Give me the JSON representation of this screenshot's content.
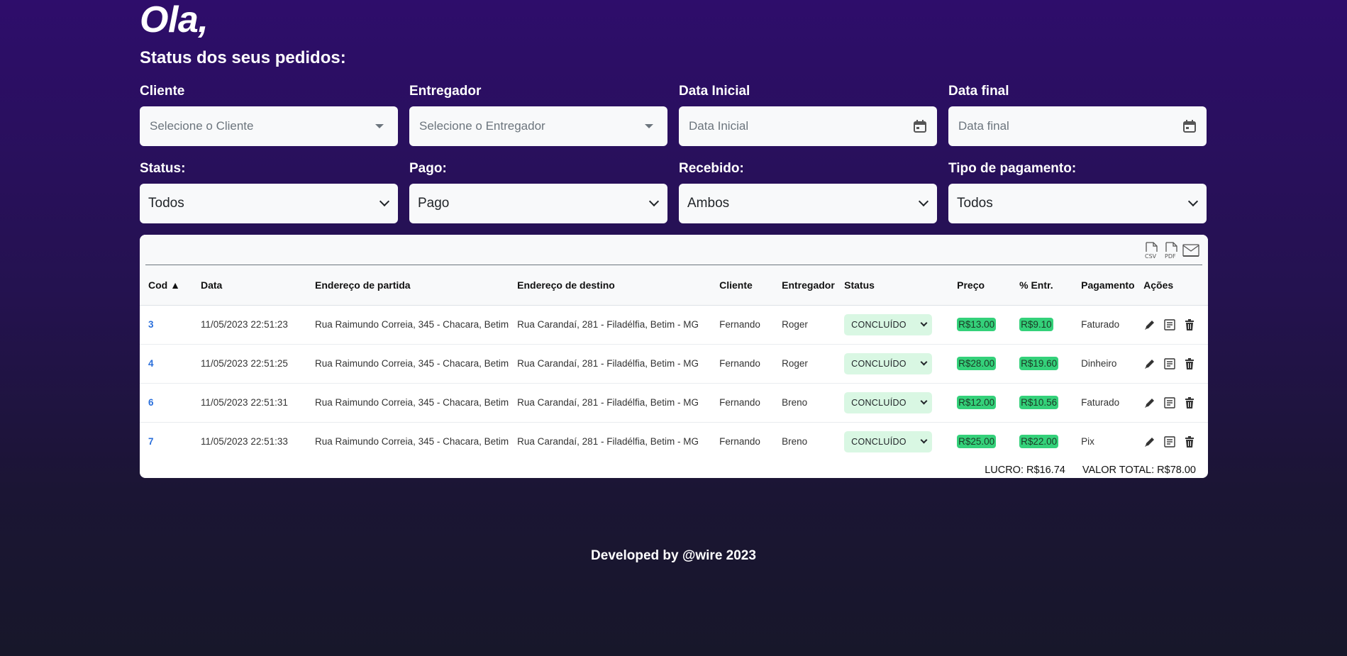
{
  "header": {
    "greeting": "Ola,",
    "subtitle": "Status dos seus pedidos:"
  },
  "filters": {
    "cliente": {
      "label": "Cliente",
      "placeholder": "Selecione o Cliente"
    },
    "entregador": {
      "label": "Entregador",
      "placeholder": "Selecione o Entregador"
    },
    "data_inicial": {
      "label": "Data Inicial",
      "placeholder": "Data Inicial"
    },
    "data_final": {
      "label": "Data final",
      "placeholder": "Data final"
    },
    "status": {
      "label": "Status:",
      "value": "Todos"
    },
    "pago": {
      "label": "Pago:",
      "value": "Pago"
    },
    "recebido": {
      "label": "Recebido:",
      "value": "Ambos"
    },
    "tipo_pagamento": {
      "label": "Tipo de pagamento:",
      "value": "Todos"
    }
  },
  "exports": {
    "csv": "CSV",
    "pdf": "PDF"
  },
  "table": {
    "columns": {
      "cod": "Cod ▲",
      "data": "Data",
      "partida": "Endereço de partida",
      "destino": "Endereço de destino",
      "cliente": "Cliente",
      "entregador": "Entregador",
      "status": "Status",
      "preco": "Preço",
      "entr": "% Entr.",
      "pagamento": "Pagamento",
      "acoes": "Ações"
    },
    "rows": [
      {
        "cod": "3",
        "data": "11/05/2023 22:51:23",
        "partida": "Rua Raimundo Correia, 345 - Chacara, Betim",
        "destino": "Rua Carandaí, 281 - Filadélfia, Betim - MG",
        "cliente": "Fernando",
        "entregador": "Roger",
        "status": "CONCLUÍDO",
        "preco": "R$13.00",
        "entr": "R$9.10",
        "pagamento": "Faturado"
      },
      {
        "cod": "4",
        "data": "11/05/2023 22:51:25",
        "partida": "Rua Raimundo Correia, 345 - Chacara, Betim",
        "destino": "Rua Carandaí, 281 - Filadélfia, Betim - MG",
        "cliente": "Fernando",
        "entregador": "Roger",
        "status": "CONCLUÍDO",
        "preco": "R$28.00",
        "entr": "R$19.60",
        "pagamento": "Dinheiro"
      },
      {
        "cod": "6",
        "data": "11/05/2023 22:51:31",
        "partida": "Rua Raimundo Correia, 345 - Chacara, Betim",
        "destino": "Rua Carandaí, 281 - Filadélfia, Betim - MG",
        "cliente": "Fernando",
        "entregador": "Breno",
        "status": "CONCLUÍDO",
        "preco": "R$12.00",
        "entr": "R$10.56",
        "pagamento": "Faturado"
      },
      {
        "cod": "7",
        "data": "11/05/2023 22:51:33",
        "partida": "Rua Raimundo Correia, 345 - Chacara, Betim",
        "destino": "Rua Carandaí, 281 - Filadélfia, Betim - MG",
        "cliente": "Fernando",
        "entregador": "Breno",
        "status": "CONCLUÍDO",
        "preco": "R$25.00",
        "entr": "R$22.00",
        "pagamento": "Pix"
      }
    ]
  },
  "totals": {
    "lucro": "LUCRO: R$16.74",
    "valor_total": "VALOR TOTAL: R$78.00"
  },
  "footer": {
    "text": "Developed by @wire 2023"
  },
  "colors": {
    "accent_link": "#2a6fdb",
    "money_badge": "#34d17a",
    "status_select": "#d9f7e3",
    "background_top": "#2e0d6b",
    "background_bottom": "#17172a"
  }
}
